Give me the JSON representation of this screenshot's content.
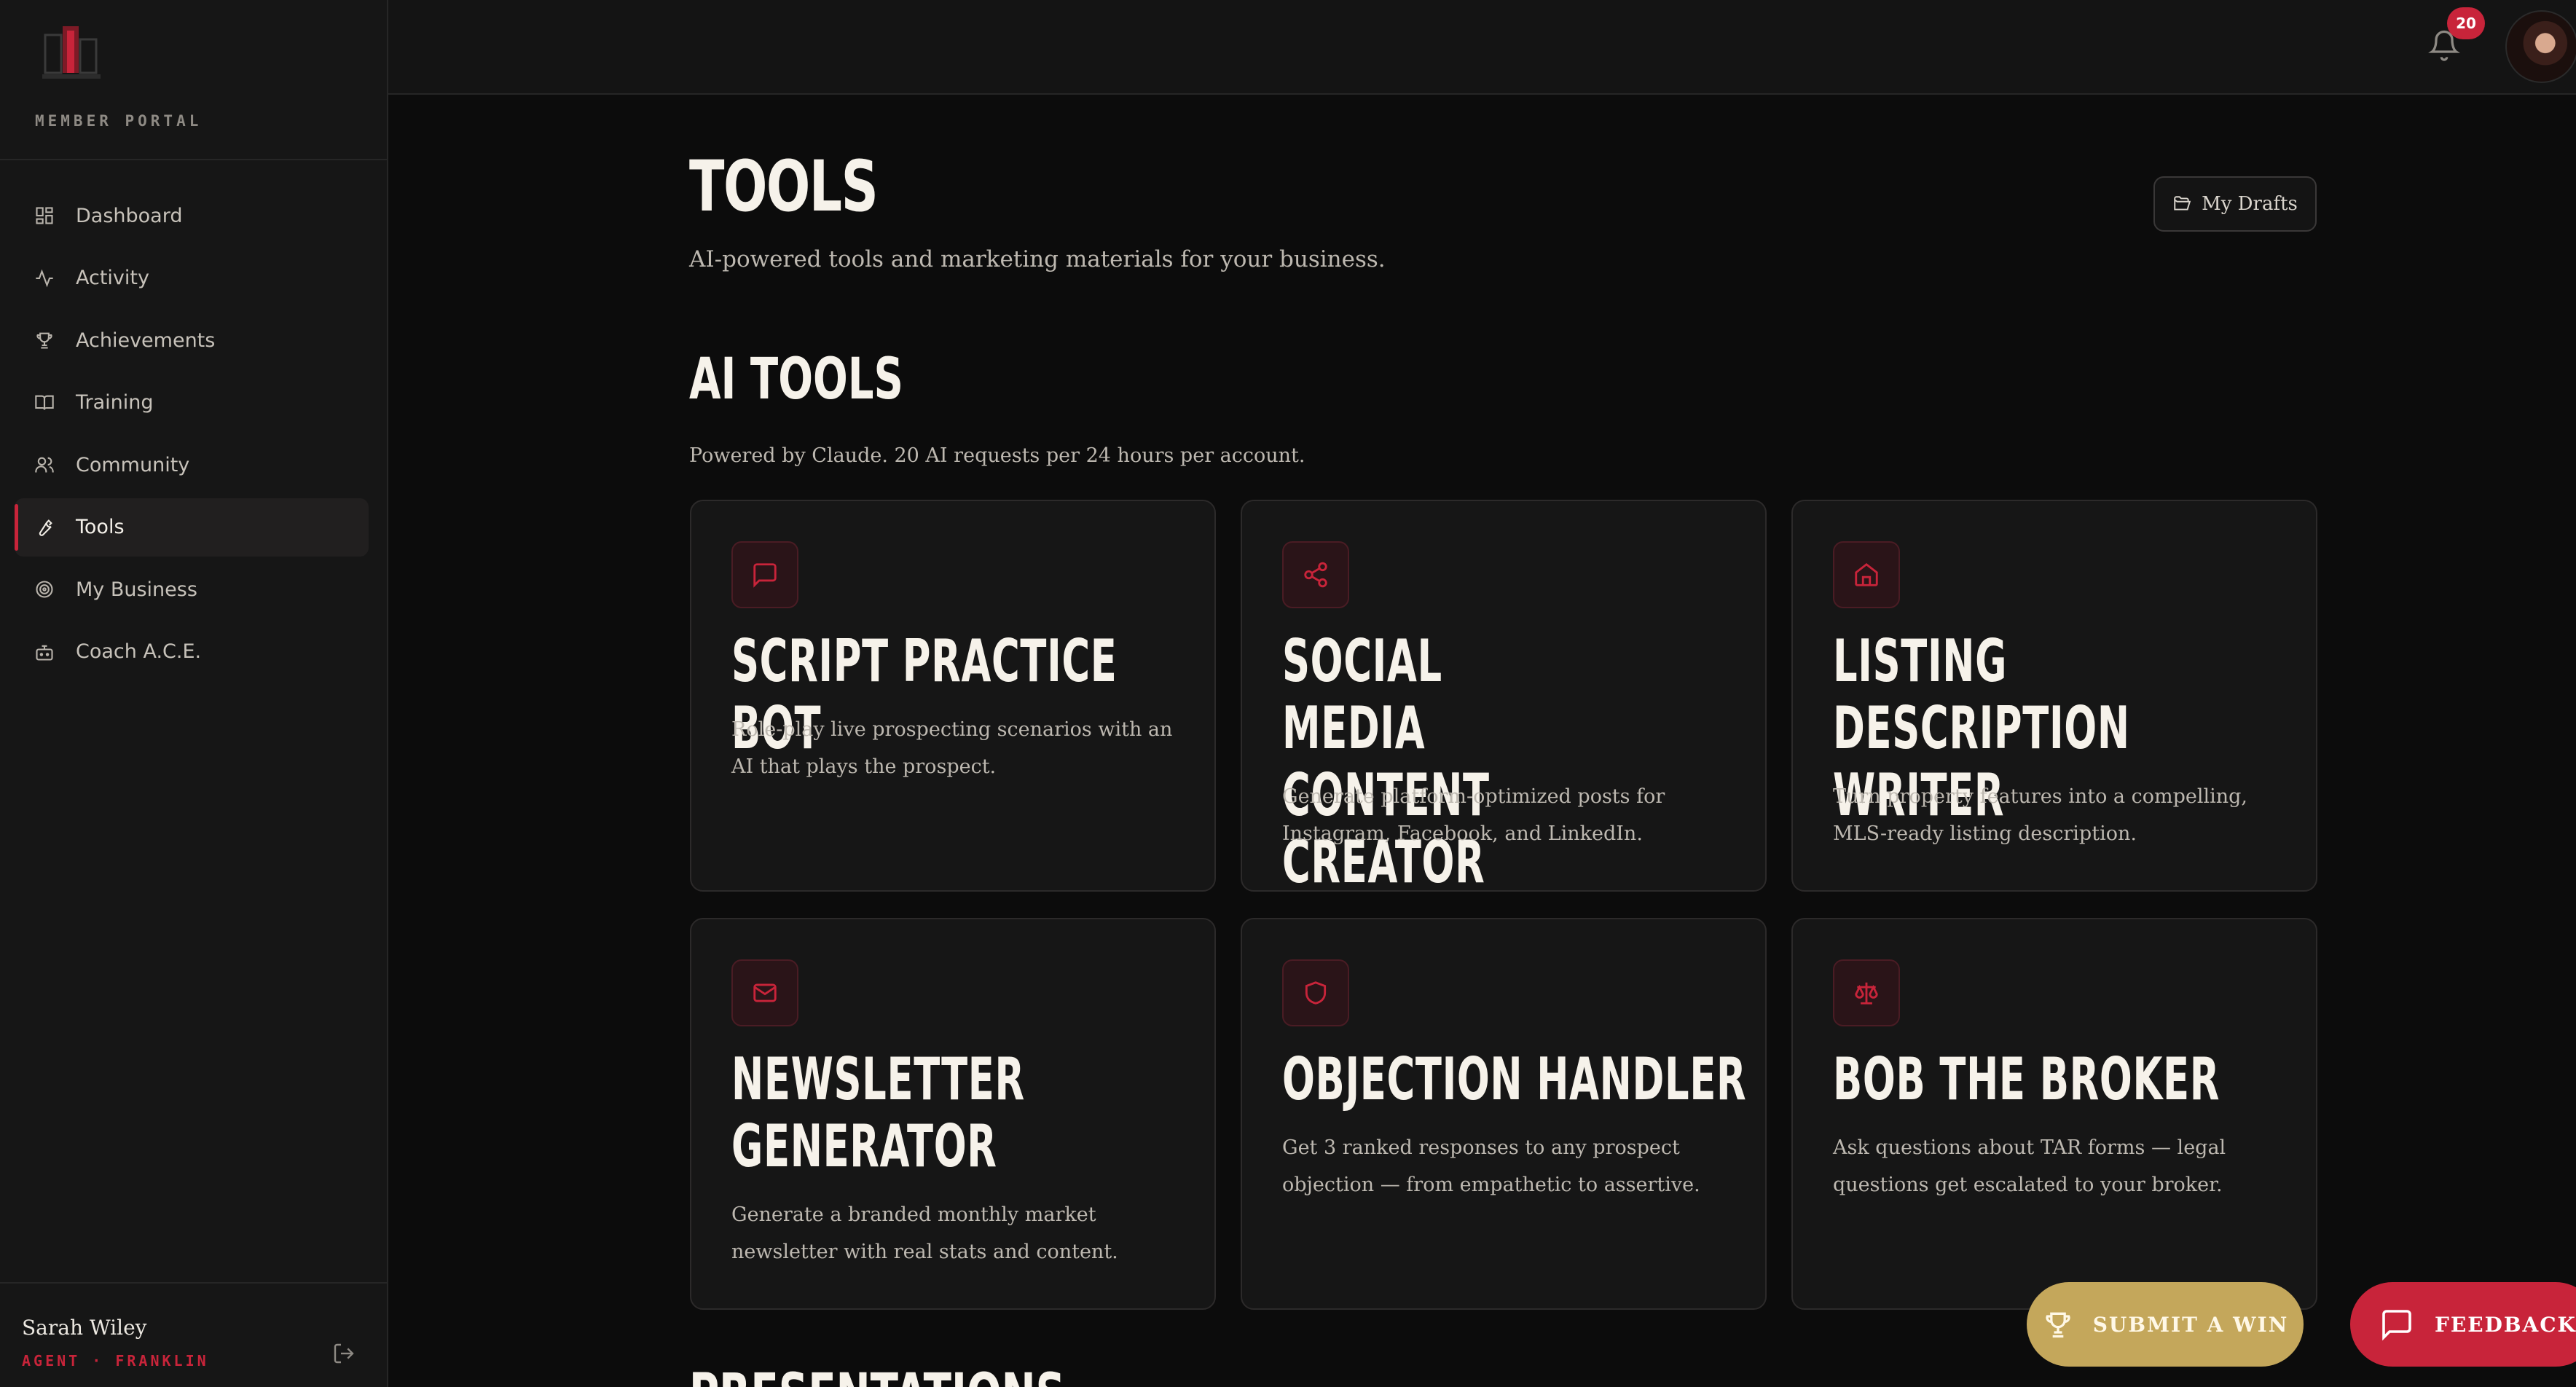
{
  "sidebar": {
    "portal_label": "MEMBER PORTAL",
    "items": [
      {
        "label": "Dashboard",
        "icon": "grid-icon"
      },
      {
        "label": "Activity",
        "icon": "activity-icon"
      },
      {
        "label": "Achievements",
        "icon": "trophy-icon"
      },
      {
        "label": "Training",
        "icon": "book-icon"
      },
      {
        "label": "Community",
        "icon": "users-icon"
      },
      {
        "label": "Tools",
        "icon": "wrench-icon",
        "active": true
      },
      {
        "label": "My Business",
        "icon": "target-icon"
      },
      {
        "label": "Coach A.C.E.",
        "icon": "bot-icon"
      }
    ],
    "user": {
      "name": "Sarah Wiley",
      "role": "AGENT · FRANKLIN"
    }
  },
  "topbar": {
    "notification_count": "20"
  },
  "page": {
    "title": "TOOLS",
    "subtitle": "AI-powered tools and marketing materials for your business.",
    "drafts_button": "My Drafts"
  },
  "ai_tools": {
    "title": "AI TOOLS",
    "subtitle": "Powered by Claude. 20 AI requests per 24 hours per account.",
    "cards": [
      {
        "title": "SCRIPT PRACTICE BOT",
        "description": "Role-play live prospecting scenarios with an AI that plays the prospect.",
        "icon": "message-square-icon"
      },
      {
        "title": "SOCIAL MEDIA CONTENT CREATOR",
        "description": "Generate platform-optimized posts for Instagram, Facebook, and LinkedIn.",
        "icon": "share-icon"
      },
      {
        "title": "LISTING DESCRIPTION WRITER",
        "description": "Turn property features into a compelling, MLS-ready listing description.",
        "icon": "home-icon"
      },
      {
        "title": "NEWSLETTER GENERATOR",
        "description": "Generate a branded monthly market newsletter with real stats and content.",
        "icon": "mail-icon"
      },
      {
        "title": "OBJECTION HANDLER",
        "description": "Get 3 ranked responses to any prospect objection — from empathetic to assertive.",
        "icon": "shield-icon"
      },
      {
        "title": "BOB THE BROKER",
        "description": "Ask questions about TAR forms — legal questions get escalated to your broker.",
        "icon": "scale-icon"
      }
    ]
  },
  "next_section": {
    "title": "PRESENTATIONS"
  },
  "floating": {
    "submit_win": "SUBMIT A WIN",
    "feedback": "FEEDBACK"
  },
  "colors": {
    "accent": "#c8243a",
    "gold": "#c4a75b",
    "background": "#0c0c0c",
    "card": "#161616"
  }
}
